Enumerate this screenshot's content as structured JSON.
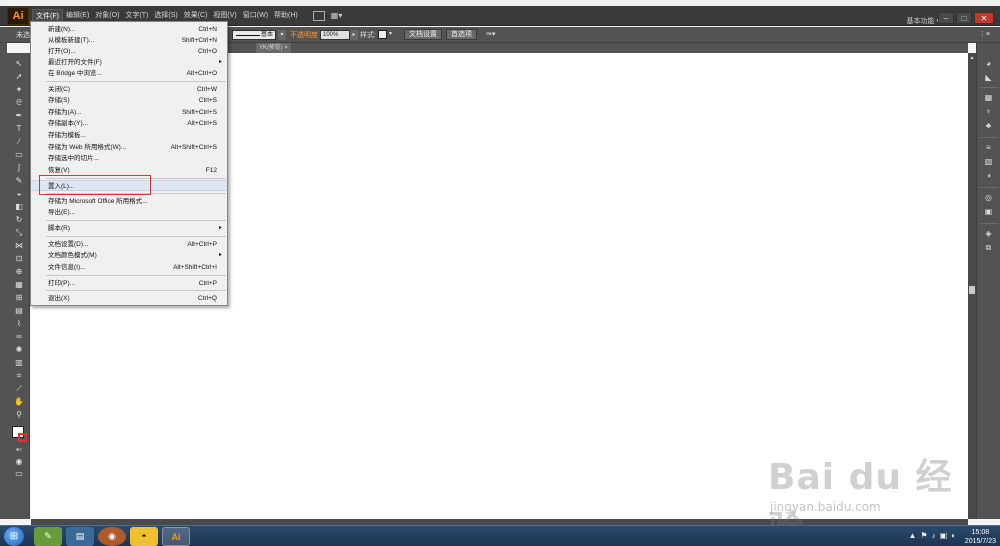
{
  "app": {
    "logo": "Ai",
    "menubar": [
      "文件(F)",
      "编辑(E)",
      "对象(O)",
      "文字(T)",
      "选择(S)",
      "效果(C)",
      "视图(V)",
      "窗口(W)",
      "帮助(H)"
    ],
    "workspace": "基本功能 ▾",
    "window_controls": [
      "–",
      "□",
      "✕"
    ]
  },
  "control_bar": {
    "left_label": "未选",
    "stroke_label": "基本",
    "opacity_label": "不透明度",
    "opacity_value": "100%",
    "style_label": "样式:",
    "doc_setup_button": "文档设置",
    "preferences_button": "首选项"
  },
  "doc_tab": {
    "label": "YK/预览)",
    "close": "×"
  },
  "file_menu": {
    "items": [
      {
        "label": "新建(N)...",
        "shortcut": "Ctrl+N"
      },
      {
        "label": "从模板新建(T)...",
        "shortcut": "Shift+Ctrl+N"
      },
      {
        "label": "打开(O)...",
        "shortcut": "Ctrl+O"
      },
      {
        "label": "最近打开的文件(F)",
        "shortcut": "",
        "submenu": true
      },
      {
        "label": "在 Bridge 中浏览...",
        "shortcut": "Alt+Ctrl+O"
      },
      {
        "label": "关闭(C)",
        "shortcut": "Ctrl+W"
      },
      {
        "label": "存储(S)",
        "shortcut": "Ctrl+S"
      },
      {
        "label": "存储为(A)...",
        "shortcut": "Shift+Ctrl+S"
      },
      {
        "label": "存储副本(Y)...",
        "shortcut": "Alt+Ctrl+S"
      },
      {
        "label": "存储为模板...",
        "shortcut": ""
      },
      {
        "label": "存储为 Web 所用格式(W)...",
        "shortcut": "Alt+Shift+Ctrl+S"
      },
      {
        "label": "存储选中的切片...",
        "shortcut": ""
      },
      {
        "label": "恢复(V)",
        "shortcut": "F12"
      },
      {
        "label": "置入(L)...",
        "shortcut": ""
      },
      {
        "label": "存储为 Microsoft Office 所用格式...",
        "shortcut": ""
      },
      {
        "label": "导出(E)...",
        "shortcut": ""
      },
      {
        "label": "脚本(R)",
        "shortcut": "",
        "submenu": true
      },
      {
        "label": "文档设置(D)...",
        "shortcut": "Alt+Ctrl+P"
      },
      {
        "label": "文档颜色模式(M)",
        "shortcut": "",
        "submenu": true
      },
      {
        "label": "文件信息(I)...",
        "shortcut": "Alt+Shift+Ctrl+I"
      },
      {
        "label": "打印(P)...",
        "shortcut": "Ctrl+P"
      },
      {
        "label": "退出(X)",
        "shortcut": "Ctrl+Q"
      }
    ],
    "submenu_arrow": "▸"
  },
  "watermark": {
    "main": "Bai du 经验",
    "sub": "jingyan.baidu.com"
  },
  "taskbar": {
    "start_icon": "⊞",
    "apps": [
      "✎",
      "▤",
      "◉",
      "◓",
      "Ai"
    ],
    "tray_icons": [
      "▲",
      "⚑",
      "♪",
      "▣",
      "◐"
    ],
    "time": "15:08",
    "date": "2015/7/23"
  },
  "colors": {
    "accent": "#ff9a00",
    "highlight_box": "#e03030",
    "menu_highlight": "#dde6f2"
  }
}
